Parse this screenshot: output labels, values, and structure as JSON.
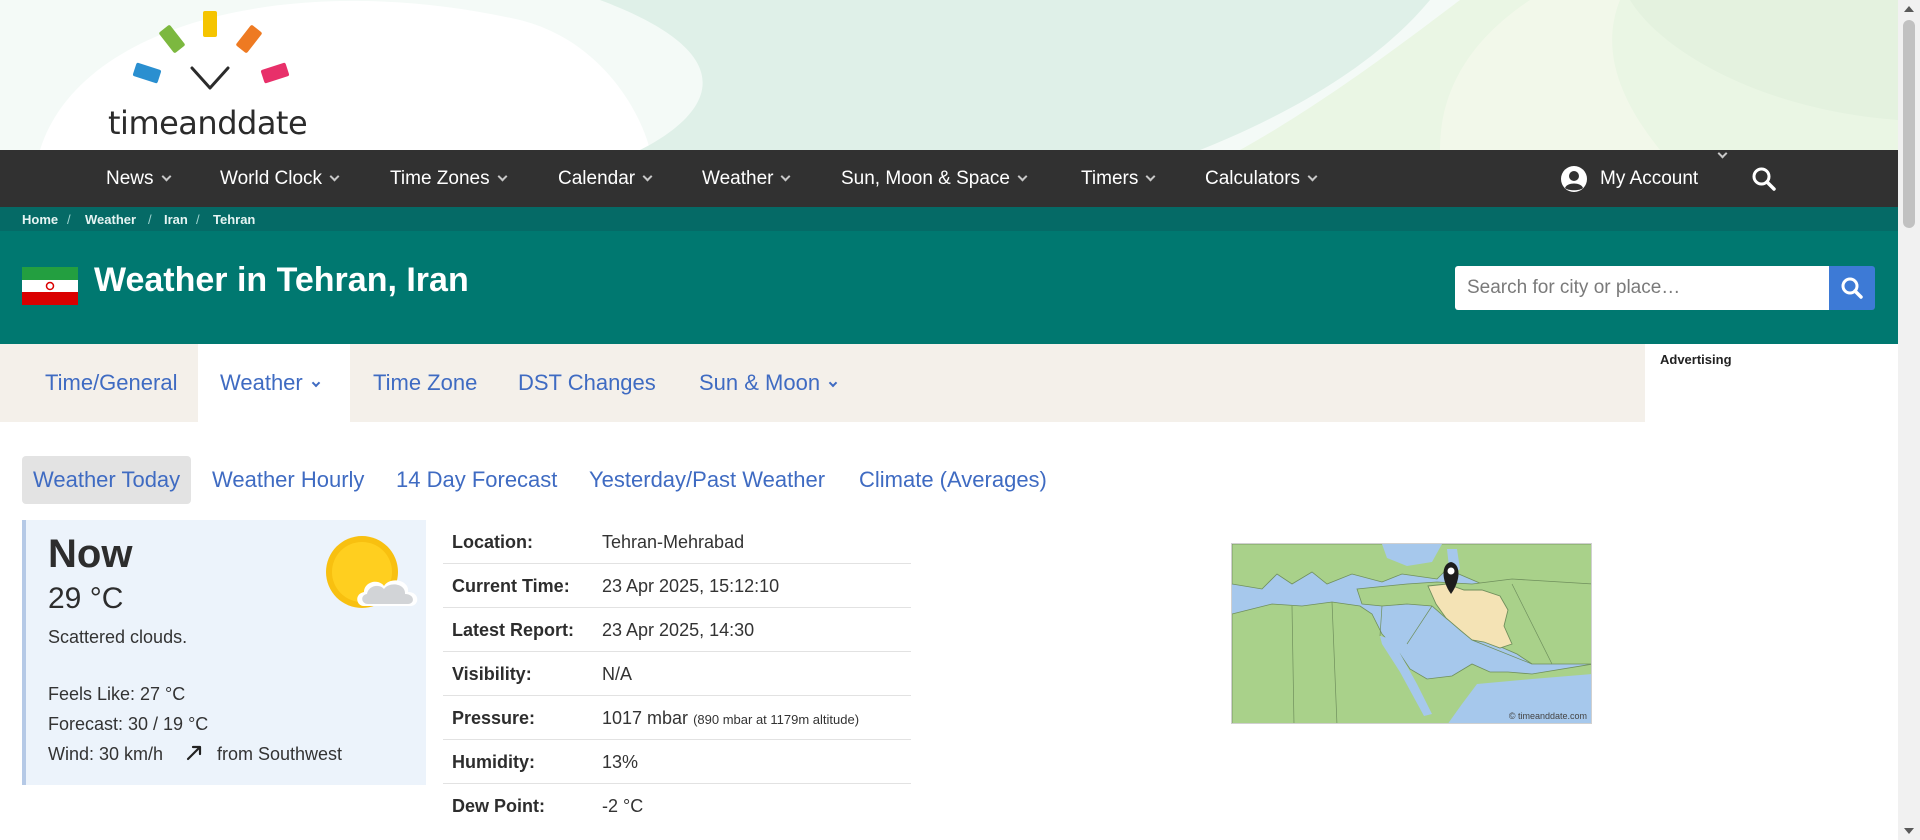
{
  "brand": {
    "logo_text_1": "time",
    "logo_text_2": "and",
    "logo_text_3": "date"
  },
  "nav": {
    "items": [
      {
        "label": "News"
      },
      {
        "label": "World Clock"
      },
      {
        "label": "Time Zones"
      },
      {
        "label": "Calendar"
      },
      {
        "label": "Weather"
      },
      {
        "label": "Sun, Moon & Space"
      },
      {
        "label": "Timers"
      },
      {
        "label": "Calculators"
      }
    ],
    "account_label": "My Account",
    "account_icon": "user-circle-icon",
    "search_icon": "search-icon"
  },
  "breadcrumb": [
    "Home",
    "Weather",
    "Iran",
    "Tehran"
  ],
  "page": {
    "title": "Weather in Tehran, Iran",
    "search_placeholder": "Search for city or place…"
  },
  "tabs": [
    {
      "label": "Time/General"
    },
    {
      "label": "Weather"
    },
    {
      "label": "Time Zone"
    },
    {
      "label": "DST Changes"
    },
    {
      "label": "Sun & Moon"
    }
  ],
  "ad_label": "Advertising",
  "subtabs": [
    {
      "label": "Weather Today"
    },
    {
      "label": "Weather Hourly"
    },
    {
      "label": "14 Day Forecast"
    },
    {
      "label": "Yesterday/Past Weather"
    },
    {
      "label": "Climate (Averages)"
    }
  ],
  "now": {
    "title": "Now",
    "temp": "29 °C",
    "description": "Scattered clouds.",
    "feels_like": "Feels Like: 27 °C",
    "forecast": "Forecast: 30 / 19 °C",
    "wind": "Wind: 30 km/h",
    "wind_from": "from Southwest",
    "icon": "partly-cloudy-icon"
  },
  "details": [
    {
      "label": "Location:",
      "value": "Tehran-Mehrabad"
    },
    {
      "label": "Current Time:",
      "value": "23 Apr 2025, 15:12:10"
    },
    {
      "label": "Latest Report:",
      "value": "23 Apr 2025, 14:30"
    },
    {
      "label": "Visibility:",
      "value": "N/A"
    },
    {
      "label": "Pressure:",
      "value": "1017 mbar",
      "note": "(890 mbar at 1179m altitude)"
    },
    {
      "label": "Humidity:",
      "value": "13%"
    },
    {
      "label": "Dew Point:",
      "value": "-2 °C"
    }
  ],
  "map": {
    "credit": "© timeanddate.com"
  },
  "colors": {
    "nav_bg": "#313131",
    "teal": "#007870",
    "link": "#3f6bc2",
    "now_bg": "#ecf3fb"
  }
}
